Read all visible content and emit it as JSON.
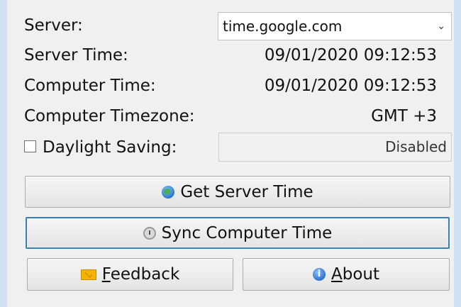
{
  "server": {
    "label": "Server:",
    "value": "time.google.com"
  },
  "server_time": {
    "label": "Server Time:",
    "value": "09/01/2020 09:12:53"
  },
  "computer_time": {
    "label": "Computer Time:",
    "value": "09/01/2020 09:12:53"
  },
  "timezone": {
    "label": "Computer Timezone:",
    "value": "GMT +3"
  },
  "daylight": {
    "label": "Daylight Saving:",
    "checked": false,
    "status": "Disabled"
  },
  "buttons": {
    "get_server_time": "Get Server Time",
    "sync_computer_time": "Sync Computer Time",
    "feedback_first": "F",
    "feedback_rest": "eedback",
    "about_first": "A",
    "about_rest": "bout"
  },
  "icons": {
    "get_server_time": "globe-icon",
    "sync_computer_time": "clock-icon",
    "feedback": "envelope-icon",
    "about": "info-icon",
    "server_dropdown": "chevron-down-icon"
  },
  "colors": {
    "window_bg": "#f0f0f0",
    "frame": "#cfe1f3",
    "focus_border": "#3c7fb1"
  }
}
